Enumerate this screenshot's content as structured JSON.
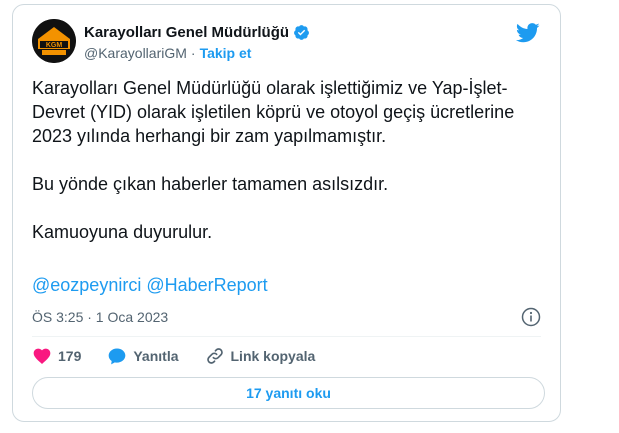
{
  "author": {
    "display_name": "Karayolları Genel Müdürlüğü",
    "handle": "@KarayollariGM",
    "separator": "·",
    "follow_label": "Takip et",
    "logo_text": "KGM"
  },
  "tweet": {
    "paragraphs": [
      "Karayolları Genel Müdürlüğü  olarak işlettiğimiz ve Yap-İşlet-Devret (YID) olarak işletilen köprü ve otoyol geçiş ücretlerine 2023 yılında herhangi bir zam yapılmamıştır.",
      "Bu yönde çıkan haberler tamamen asılsızdır.",
      "Kamuoyuna duyurulur."
    ],
    "mentions": [
      "@eozpeynirci",
      "@HaberReport"
    ],
    "timestamp": "ÖS 3:25 · 1 Oca 2023"
  },
  "actions": {
    "like_count": "179",
    "reply_label": "Yanıtla",
    "copy_link_label": "Link kopyala"
  },
  "replies_button_label": "17 yanıtı oku",
  "colors": {
    "accent": "#1d9bf0",
    "like": "#f91880",
    "text": "#0f1419",
    "secondary": "#536471",
    "border": "#cfd9de"
  }
}
